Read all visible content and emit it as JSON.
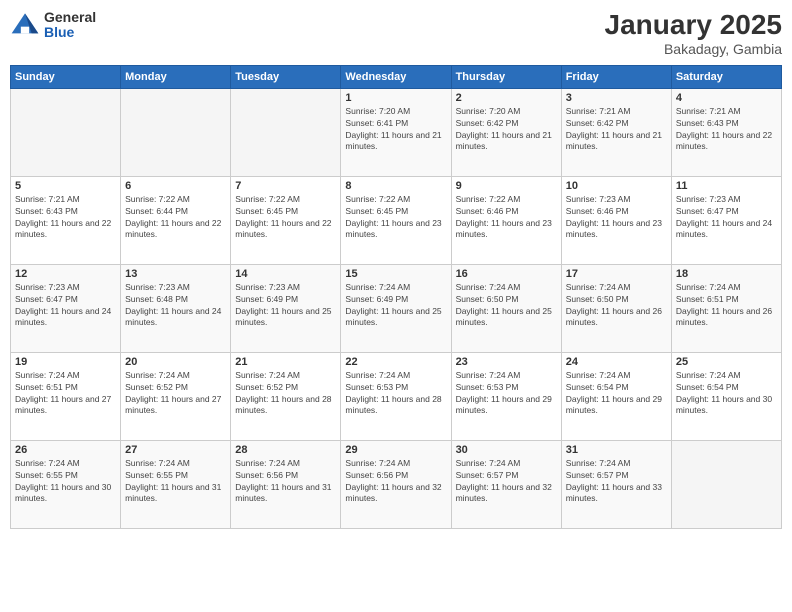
{
  "logo": {
    "general": "General",
    "blue": "Blue"
  },
  "header": {
    "month": "January 2025",
    "location": "Bakadagy, Gambia"
  },
  "days_header": [
    "Sunday",
    "Monday",
    "Tuesday",
    "Wednesday",
    "Thursday",
    "Friday",
    "Saturday"
  ],
  "weeks": [
    [
      {
        "day": "",
        "sunrise": "",
        "sunset": "",
        "daylight": ""
      },
      {
        "day": "",
        "sunrise": "",
        "sunset": "",
        "daylight": ""
      },
      {
        "day": "",
        "sunrise": "",
        "sunset": "",
        "daylight": ""
      },
      {
        "day": "1",
        "sunrise": "Sunrise: 7:20 AM",
        "sunset": "Sunset: 6:41 PM",
        "daylight": "Daylight: 11 hours and 21 minutes."
      },
      {
        "day": "2",
        "sunrise": "Sunrise: 7:20 AM",
        "sunset": "Sunset: 6:42 PM",
        "daylight": "Daylight: 11 hours and 21 minutes."
      },
      {
        "day": "3",
        "sunrise": "Sunrise: 7:21 AM",
        "sunset": "Sunset: 6:42 PM",
        "daylight": "Daylight: 11 hours and 21 minutes."
      },
      {
        "day": "4",
        "sunrise": "Sunrise: 7:21 AM",
        "sunset": "Sunset: 6:43 PM",
        "daylight": "Daylight: 11 hours and 22 minutes."
      }
    ],
    [
      {
        "day": "5",
        "sunrise": "Sunrise: 7:21 AM",
        "sunset": "Sunset: 6:43 PM",
        "daylight": "Daylight: 11 hours and 22 minutes."
      },
      {
        "day": "6",
        "sunrise": "Sunrise: 7:22 AM",
        "sunset": "Sunset: 6:44 PM",
        "daylight": "Daylight: 11 hours and 22 minutes."
      },
      {
        "day": "7",
        "sunrise": "Sunrise: 7:22 AM",
        "sunset": "Sunset: 6:45 PM",
        "daylight": "Daylight: 11 hours and 22 minutes."
      },
      {
        "day": "8",
        "sunrise": "Sunrise: 7:22 AM",
        "sunset": "Sunset: 6:45 PM",
        "daylight": "Daylight: 11 hours and 23 minutes."
      },
      {
        "day": "9",
        "sunrise": "Sunrise: 7:22 AM",
        "sunset": "Sunset: 6:46 PM",
        "daylight": "Daylight: 11 hours and 23 minutes."
      },
      {
        "day": "10",
        "sunrise": "Sunrise: 7:23 AM",
        "sunset": "Sunset: 6:46 PM",
        "daylight": "Daylight: 11 hours and 23 minutes."
      },
      {
        "day": "11",
        "sunrise": "Sunrise: 7:23 AM",
        "sunset": "Sunset: 6:47 PM",
        "daylight": "Daylight: 11 hours and 24 minutes."
      }
    ],
    [
      {
        "day": "12",
        "sunrise": "Sunrise: 7:23 AM",
        "sunset": "Sunset: 6:47 PM",
        "daylight": "Daylight: 11 hours and 24 minutes."
      },
      {
        "day": "13",
        "sunrise": "Sunrise: 7:23 AM",
        "sunset": "Sunset: 6:48 PM",
        "daylight": "Daylight: 11 hours and 24 minutes."
      },
      {
        "day": "14",
        "sunrise": "Sunrise: 7:23 AM",
        "sunset": "Sunset: 6:49 PM",
        "daylight": "Daylight: 11 hours and 25 minutes."
      },
      {
        "day": "15",
        "sunrise": "Sunrise: 7:24 AM",
        "sunset": "Sunset: 6:49 PM",
        "daylight": "Daylight: 11 hours and 25 minutes."
      },
      {
        "day": "16",
        "sunrise": "Sunrise: 7:24 AM",
        "sunset": "Sunset: 6:50 PM",
        "daylight": "Daylight: 11 hours and 25 minutes."
      },
      {
        "day": "17",
        "sunrise": "Sunrise: 7:24 AM",
        "sunset": "Sunset: 6:50 PM",
        "daylight": "Daylight: 11 hours and 26 minutes."
      },
      {
        "day": "18",
        "sunrise": "Sunrise: 7:24 AM",
        "sunset": "Sunset: 6:51 PM",
        "daylight": "Daylight: 11 hours and 26 minutes."
      }
    ],
    [
      {
        "day": "19",
        "sunrise": "Sunrise: 7:24 AM",
        "sunset": "Sunset: 6:51 PM",
        "daylight": "Daylight: 11 hours and 27 minutes."
      },
      {
        "day": "20",
        "sunrise": "Sunrise: 7:24 AM",
        "sunset": "Sunset: 6:52 PM",
        "daylight": "Daylight: 11 hours and 27 minutes."
      },
      {
        "day": "21",
        "sunrise": "Sunrise: 7:24 AM",
        "sunset": "Sunset: 6:52 PM",
        "daylight": "Daylight: 11 hours and 28 minutes."
      },
      {
        "day": "22",
        "sunrise": "Sunrise: 7:24 AM",
        "sunset": "Sunset: 6:53 PM",
        "daylight": "Daylight: 11 hours and 28 minutes."
      },
      {
        "day": "23",
        "sunrise": "Sunrise: 7:24 AM",
        "sunset": "Sunset: 6:53 PM",
        "daylight": "Daylight: 11 hours and 29 minutes."
      },
      {
        "day": "24",
        "sunrise": "Sunrise: 7:24 AM",
        "sunset": "Sunset: 6:54 PM",
        "daylight": "Daylight: 11 hours and 29 minutes."
      },
      {
        "day": "25",
        "sunrise": "Sunrise: 7:24 AM",
        "sunset": "Sunset: 6:54 PM",
        "daylight": "Daylight: 11 hours and 30 minutes."
      }
    ],
    [
      {
        "day": "26",
        "sunrise": "Sunrise: 7:24 AM",
        "sunset": "Sunset: 6:55 PM",
        "daylight": "Daylight: 11 hours and 30 minutes."
      },
      {
        "day": "27",
        "sunrise": "Sunrise: 7:24 AM",
        "sunset": "Sunset: 6:55 PM",
        "daylight": "Daylight: 11 hours and 31 minutes."
      },
      {
        "day": "28",
        "sunrise": "Sunrise: 7:24 AM",
        "sunset": "Sunset: 6:56 PM",
        "daylight": "Daylight: 11 hours and 31 minutes."
      },
      {
        "day": "29",
        "sunrise": "Sunrise: 7:24 AM",
        "sunset": "Sunset: 6:56 PM",
        "daylight": "Daylight: 11 hours and 32 minutes."
      },
      {
        "day": "30",
        "sunrise": "Sunrise: 7:24 AM",
        "sunset": "Sunset: 6:57 PM",
        "daylight": "Daylight: 11 hours and 32 minutes."
      },
      {
        "day": "31",
        "sunrise": "Sunrise: 7:24 AM",
        "sunset": "Sunset: 6:57 PM",
        "daylight": "Daylight: 11 hours and 33 minutes."
      },
      {
        "day": "",
        "sunrise": "",
        "sunset": "",
        "daylight": ""
      }
    ]
  ]
}
